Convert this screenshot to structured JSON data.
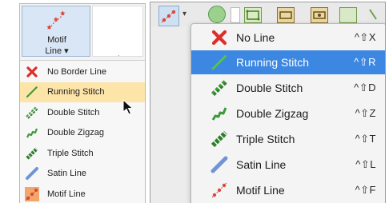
{
  "left_panel": {
    "motif_button": {
      "label_line1": "Motif",
      "label_line2": "Line ▾"
    },
    "menu_items": [
      {
        "label": "No Border Line",
        "icon": "red-x-icon"
      },
      {
        "label": "Running Stitch",
        "icon": "running-stitch-icon",
        "selected": true
      },
      {
        "label": "Double Stitch",
        "icon": "double-stitch-icon"
      },
      {
        "label": "Double Zigzag",
        "icon": "double-zigzag-icon"
      },
      {
        "label": "Triple Stitch",
        "icon": "triple-stitch-icon"
      },
      {
        "label": "Satin Line",
        "icon": "satin-line-icon"
      },
      {
        "label": "Motif Line",
        "icon": "motif-line-icon"
      }
    ]
  },
  "right_panel": {
    "menu_items": [
      {
        "label": "No Line",
        "shortcut": "^⇧X",
        "icon": "red-x-icon"
      },
      {
        "label": "Running Stitch",
        "shortcut": "^⇧R",
        "icon": "running-stitch-icon",
        "highlighted": true
      },
      {
        "label": "Double Stitch",
        "shortcut": "^⇧D",
        "icon": "double-stitch-icon"
      },
      {
        "label": "Double Zigzag",
        "shortcut": "^⇧Z",
        "icon": "double-zigzag-icon"
      },
      {
        "label": "Triple Stitch",
        "shortcut": "^⇧T",
        "icon": "triple-stitch-icon"
      },
      {
        "label": "Satin Line",
        "shortcut": "^⇧L",
        "icon": "satin-line-icon"
      },
      {
        "label": "Motif Line",
        "shortcut": "^⇧F",
        "icon": "motif-line-icon"
      }
    ]
  },
  "colors": {
    "highlight_blue": "#3c87e2",
    "selected_yellow": "#fde4a8",
    "stitch_green": "#3f9a3a",
    "x_red": "#d9302b",
    "satin_blue": "#6f95d6",
    "motif_red": "#d6453a"
  }
}
